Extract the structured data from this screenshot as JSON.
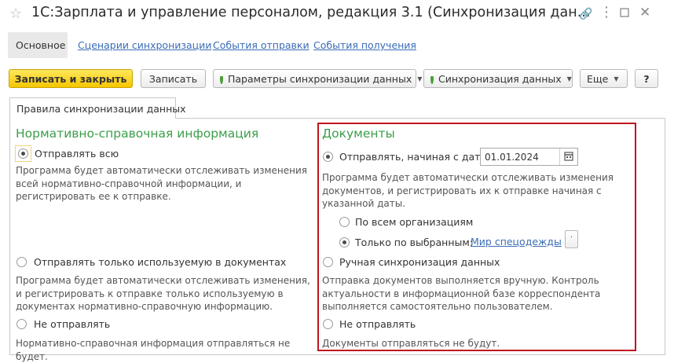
{
  "window": {
    "title": "1С:Зарплата и управление персоналом, редакция 3.1 (Синхронизация дан..."
  },
  "nav": {
    "active": "Основное",
    "links": [
      "Сценарии синхронизации",
      "События отправки",
      "События получения"
    ]
  },
  "toolbar": {
    "save_close": "Записать и закрыть",
    "save": "Записать",
    "sync_params": "Параметры синхронизации данных",
    "sync_data": "Синхронизация данных",
    "more": "Еще",
    "help": "?"
  },
  "tab": {
    "label": "Правила синхронизации данных"
  },
  "nsi": {
    "heading": "Нормативно-справочная информация",
    "opt_all": "Отправлять всю",
    "opt_all_desc": "Программа будет автоматически отслеживать изменения всей нормативно-справочной информации, и регистрировать ее к отправке.",
    "opt_used": "Отправлять только используемую в документах",
    "opt_used_desc": "Программа будет автоматически отслеживать изменения, и регистрировать к отправке только используемую в документах нормативно-справочную информацию.",
    "opt_none": "Не отправлять",
    "opt_none_desc": "Нормативно-справочная информация отправляться не будет.",
    "selected": "all"
  },
  "docs": {
    "heading": "Документы",
    "opt_from_date": "Отправлять, начиная с даты",
    "date_value": "01.01.2024",
    "opt_from_date_desc": "Программа будет автоматически отслеживать изменения документов, и регистрировать их к отправке начиная с указанной даты.",
    "org_all": "По всем организациям",
    "org_selected": "Только по выбранным:",
    "org_link": "Мир спецодежды",
    "opt_manual": "Ручная синхронизация данных",
    "opt_manual_desc": "Отправка документов выполняется вручную. Контроль актуальности в информационной базе корреспондента выполняется самостоятельно пользователем.",
    "opt_none": "Не отправлять",
    "opt_none_desc": "Документы отправляться не будут.",
    "selected": "from_date",
    "org_mode": "selected"
  },
  "colors": {
    "accent_green": "#3b9e4a",
    "link_blue": "#3a6cb5",
    "highlight_red": "#c0161f",
    "primary_yellow": "#f5c600"
  }
}
